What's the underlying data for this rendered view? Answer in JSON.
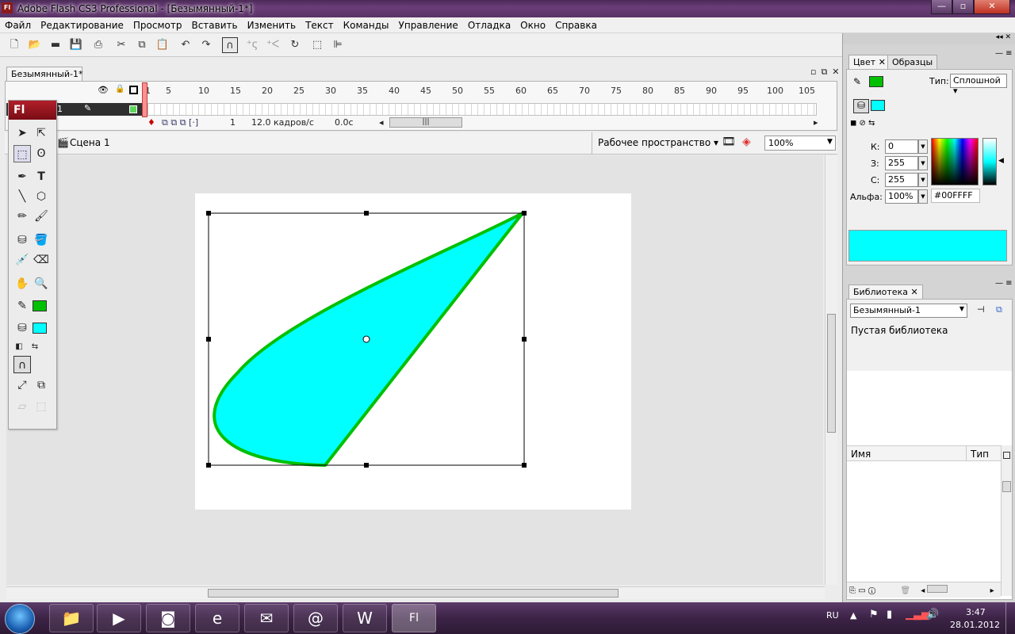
{
  "window": {
    "title": "Adobe Flash CS3 Professional - [Безымянный-1*]",
    "app_icon": "Fl",
    "min": "—",
    "max": "▫",
    "close": "✕"
  },
  "menu": [
    "Файл",
    "Редактирование",
    "Просмотр",
    "Вставить",
    "Изменить",
    "Текст",
    "Команды",
    "Управление",
    "Отладка",
    "Окно",
    "Справка"
  ],
  "document": {
    "tab": "Безымянный-1*",
    "ruler_ticks": [
      "1",
      "5",
      "10",
      "15",
      "20",
      "25",
      "30",
      "35",
      "40",
      "45",
      "50",
      "55",
      "60",
      "65",
      "70",
      "75",
      "80",
      "85",
      "90",
      "95",
      "100",
      "105"
    ],
    "layer_name": "1",
    "status": {
      "frame": "1",
      "fps": "12.0 кадров/с",
      "time": "0.0с"
    },
    "scene": "Сцена 1",
    "workspace": "Рабочее пространство",
    "zoom": "100%"
  },
  "shape": {
    "fill": "#00FFFF",
    "stroke": "#00C000"
  },
  "color_panel": {
    "tab_color": "Цвет",
    "tab_swatches": "Образцы",
    "type_label": "Тип:",
    "type_value": "Сплошной",
    "k_label": "К:",
    "k_value": "0",
    "z_label": "З:",
    "z_value": "255",
    "c_label": "С:",
    "c_value": "255",
    "alpha_label": "Альфа:",
    "alpha_value": "100%",
    "hex": "#00FFFF",
    "stroke_color": "#00C000",
    "fill_color": "#00FFFF"
  },
  "library_panel": {
    "tab": "Библиотека",
    "doc_select": "Безымянный-1",
    "empty_text": "Пустая библиотека",
    "col_name": "Имя",
    "col_type": "Тип"
  },
  "tray": {
    "lang": "RU",
    "time": "3:47",
    "date": "28.01.2012"
  },
  "tools_title": "Fl"
}
